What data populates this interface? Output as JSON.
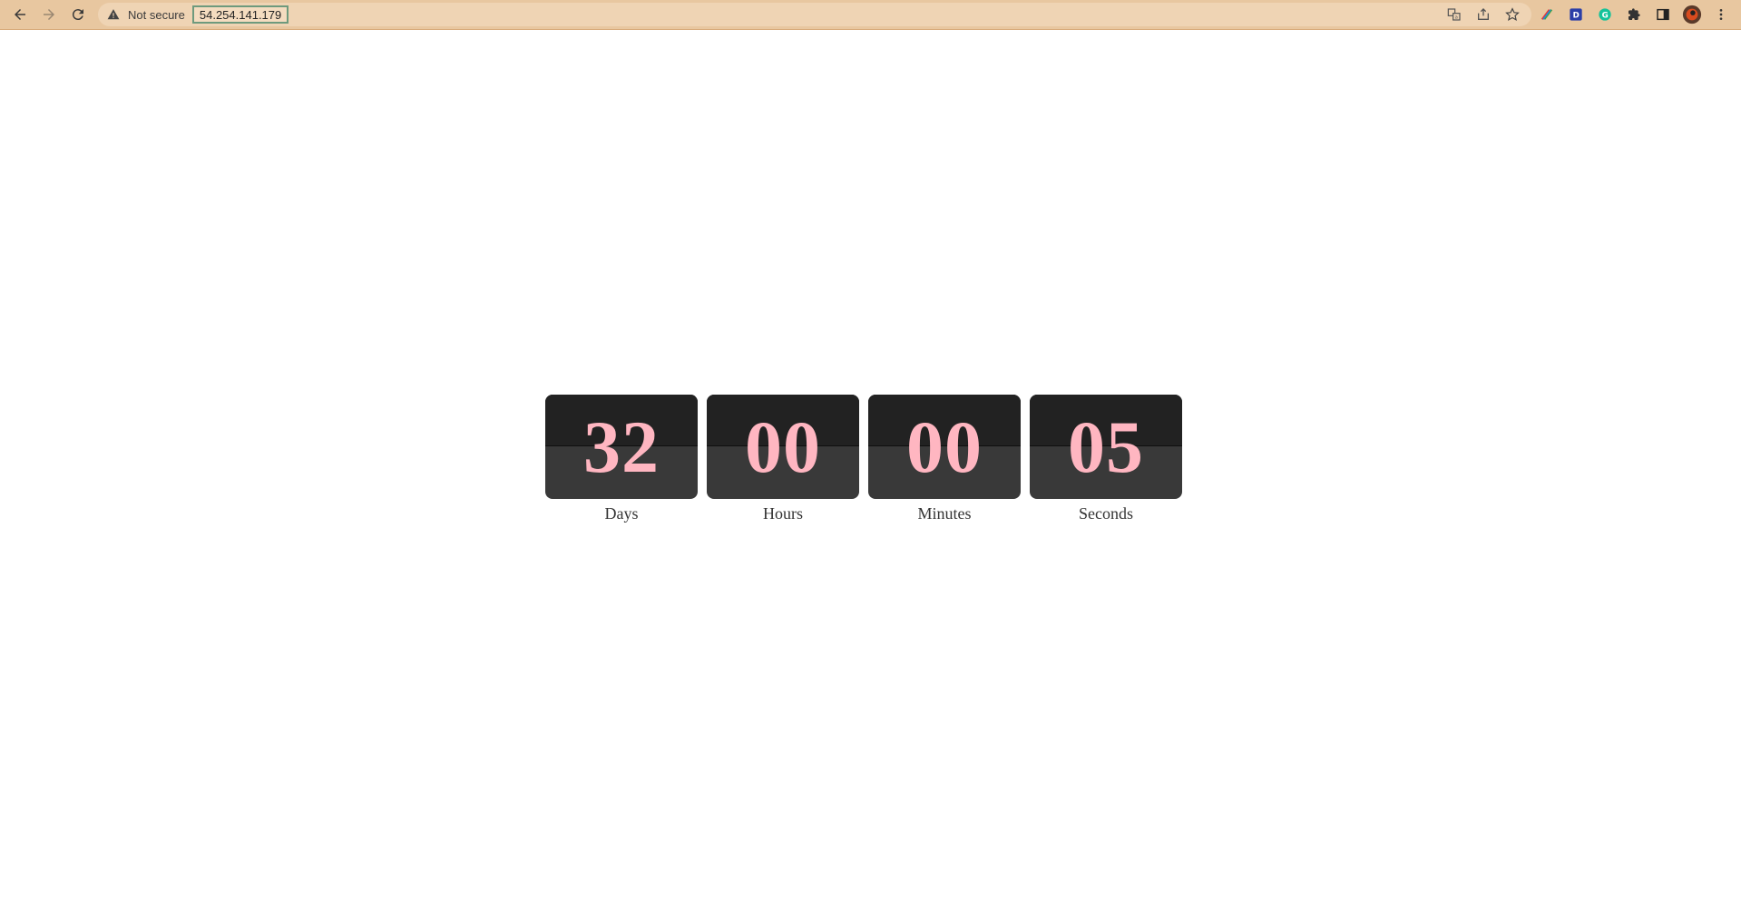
{
  "browser": {
    "security_label": "Not secure",
    "url": "54.254.141.179",
    "icons": {
      "back": "back-arrow-icon",
      "forward": "forward-arrow-icon",
      "reload": "reload-icon",
      "warning": "warning-triangle-icon",
      "translate": "translate-icon",
      "share": "share-icon",
      "bookmark": "star-icon",
      "extension1": "color-picker-extension-icon",
      "extension2": "d-extension-icon",
      "extension3": "grammarly-extension-icon",
      "extensions": "puzzle-icon",
      "sidepanel": "side-panel-icon",
      "profile": "avatar-icon",
      "menu": "kebab-menu-icon"
    },
    "colors": {
      "toolbar": "#e8c7a0"
    }
  },
  "countdown": {
    "digit_color": "#ffb6c1",
    "units": [
      {
        "value": "32",
        "label": "Days"
      },
      {
        "value": "00",
        "label": "Hours"
      },
      {
        "value": "00",
        "label": "Minutes"
      },
      {
        "value": "05",
        "label": "Seconds"
      }
    ]
  }
}
